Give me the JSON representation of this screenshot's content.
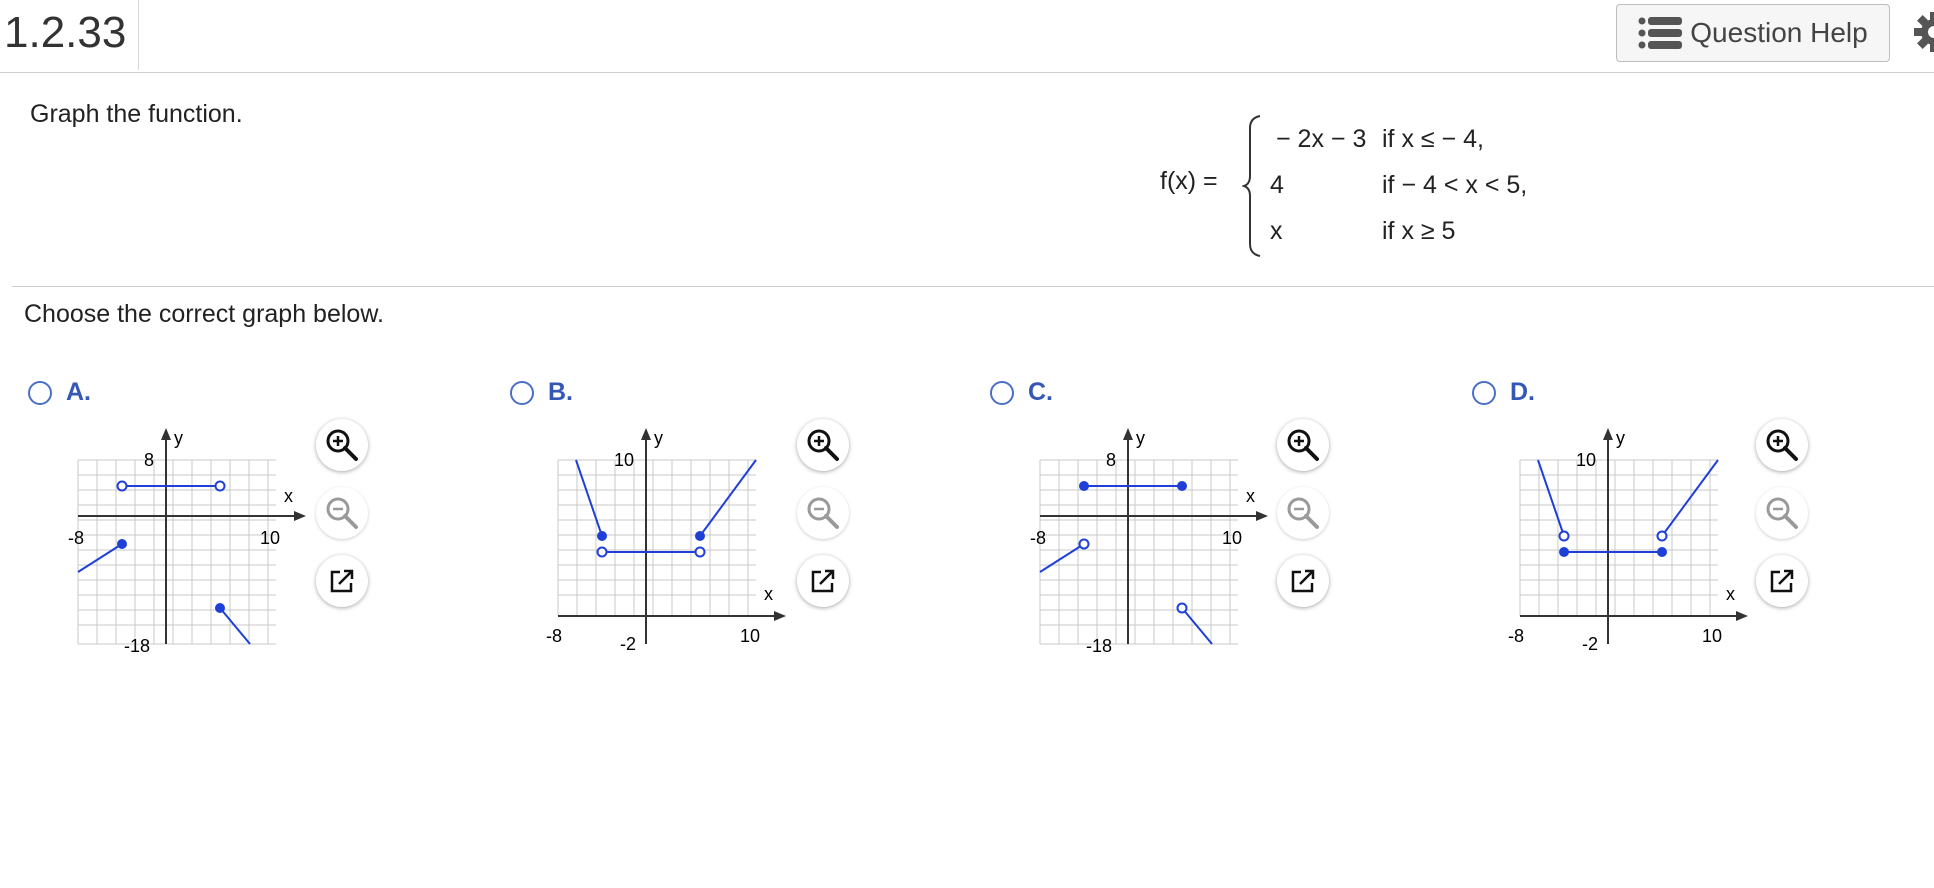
{
  "header": {
    "question_number": "1.2.33",
    "help_label": "Question Help"
  },
  "prompt": "Graph the function.",
  "function": {
    "lhs": "f(x) =",
    "pieces": [
      {
        "expr": "− 2x − 3",
        "cond": "if x ≤ − 4,"
      },
      {
        "expr": "4",
        "cond": "if − 4 < x < 5,"
      },
      {
        "expr": "x",
        "cond": "if x ≥ 5"
      }
    ]
  },
  "choose_text": "Choose the correct graph below.",
  "choices": [
    {
      "letter": "A.",
      "axis": {
        "y_name": "y",
        "x_name": "x",
        "xmin_label": "-8",
        "xmax_label": "10",
        "ytop_label": "8",
        "ybottom_label": "-18"
      }
    },
    {
      "letter": "B.",
      "axis": {
        "y_name": "y",
        "x_name": "x",
        "xmin_label": "-8",
        "xmax_label": "10",
        "ytop_label": "10",
        "ybottom_label": "-2"
      }
    },
    {
      "letter": "C.",
      "axis": {
        "y_name": "y",
        "x_name": "x",
        "xmin_label": "-8",
        "xmax_label": "10",
        "ytop_label": "8",
        "ybottom_label": "-18"
      }
    },
    {
      "letter": "D.",
      "axis": {
        "y_name": "y",
        "x_name": "x",
        "xmin_label": "-8",
        "xmax_label": "10",
        "ytop_label": "10",
        "ybottom_label": "-2"
      }
    }
  ],
  "colors": {
    "curve": "#1f3fd9",
    "accent": "#3557b7",
    "grid": "#c8c8c8",
    "axis": "#333333"
  },
  "icons": {
    "help": "list-icon",
    "settings": "gear-icon",
    "zoom_in": "zoom-in-icon",
    "zoom_out": "zoom-out-icon",
    "popout": "popout-icon"
  }
}
